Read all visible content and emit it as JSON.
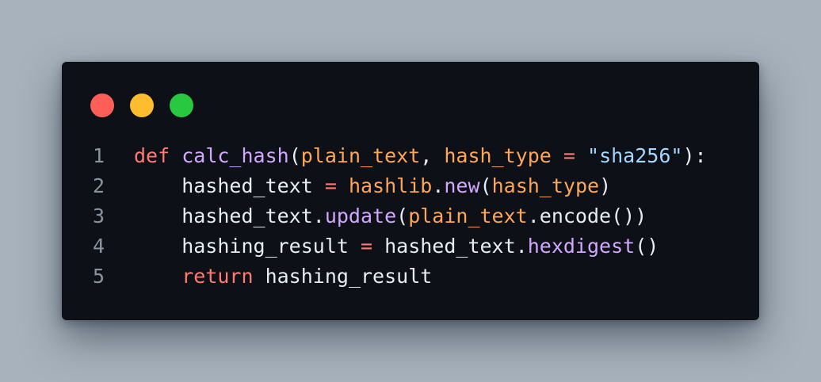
{
  "window": {
    "traffic_lights": [
      {
        "name": "close",
        "color": "#ff5f57"
      },
      {
        "name": "minimize",
        "color": "#febc2e"
      },
      {
        "name": "maximize",
        "color": "#28c840"
      }
    ]
  },
  "theme": {
    "background": "#0d1117",
    "keyword": "#ff7b72",
    "function": "#d2a8ff",
    "variable": "#ffa657",
    "string": "#a5d6ff",
    "text": "#e6edf3",
    "line_number": "#8b949e"
  },
  "code": {
    "language": "python",
    "lines": [
      {
        "number": "1",
        "tokens": [
          {
            "text": "def",
            "type": "kw"
          },
          {
            "text": " ",
            "type": "plain"
          },
          {
            "text": "calc_hash",
            "type": "fn"
          },
          {
            "text": "(",
            "type": "plain"
          },
          {
            "text": "plain_text",
            "type": "var"
          },
          {
            "text": ", ",
            "type": "plain"
          },
          {
            "text": "hash_type",
            "type": "var"
          },
          {
            "text": " ",
            "type": "plain"
          },
          {
            "text": "=",
            "type": "op"
          },
          {
            "text": " ",
            "type": "plain"
          },
          {
            "text": "\"sha256\"",
            "type": "str"
          },
          {
            "text": "):",
            "type": "plain"
          }
        ]
      },
      {
        "number": "2",
        "tokens": [
          {
            "text": "    hashed_text ",
            "type": "plain"
          },
          {
            "text": "=",
            "type": "op"
          },
          {
            "text": " ",
            "type": "plain"
          },
          {
            "text": "hashlib",
            "type": "var"
          },
          {
            "text": ".",
            "type": "plain"
          },
          {
            "text": "new",
            "type": "fn"
          },
          {
            "text": "(",
            "type": "plain"
          },
          {
            "text": "hash_type",
            "type": "var"
          },
          {
            "text": ")",
            "type": "plain"
          }
        ]
      },
      {
        "number": "3",
        "tokens": [
          {
            "text": "    hashed_text.",
            "type": "plain"
          },
          {
            "text": "update",
            "type": "fn"
          },
          {
            "text": "(",
            "type": "plain"
          },
          {
            "text": "plain_text",
            "type": "var"
          },
          {
            "text": ".encode())",
            "type": "plain"
          }
        ]
      },
      {
        "number": "4",
        "tokens": [
          {
            "text": "    hashing_result ",
            "type": "plain"
          },
          {
            "text": "=",
            "type": "op"
          },
          {
            "text": " hashed_text.",
            "type": "plain"
          },
          {
            "text": "hexdigest",
            "type": "fn"
          },
          {
            "text": "()",
            "type": "plain"
          }
        ]
      },
      {
        "number": "5",
        "tokens": [
          {
            "text": "    ",
            "type": "plain"
          },
          {
            "text": "return",
            "type": "kw"
          },
          {
            "text": " hashing_result",
            "type": "plain"
          }
        ]
      }
    ]
  }
}
